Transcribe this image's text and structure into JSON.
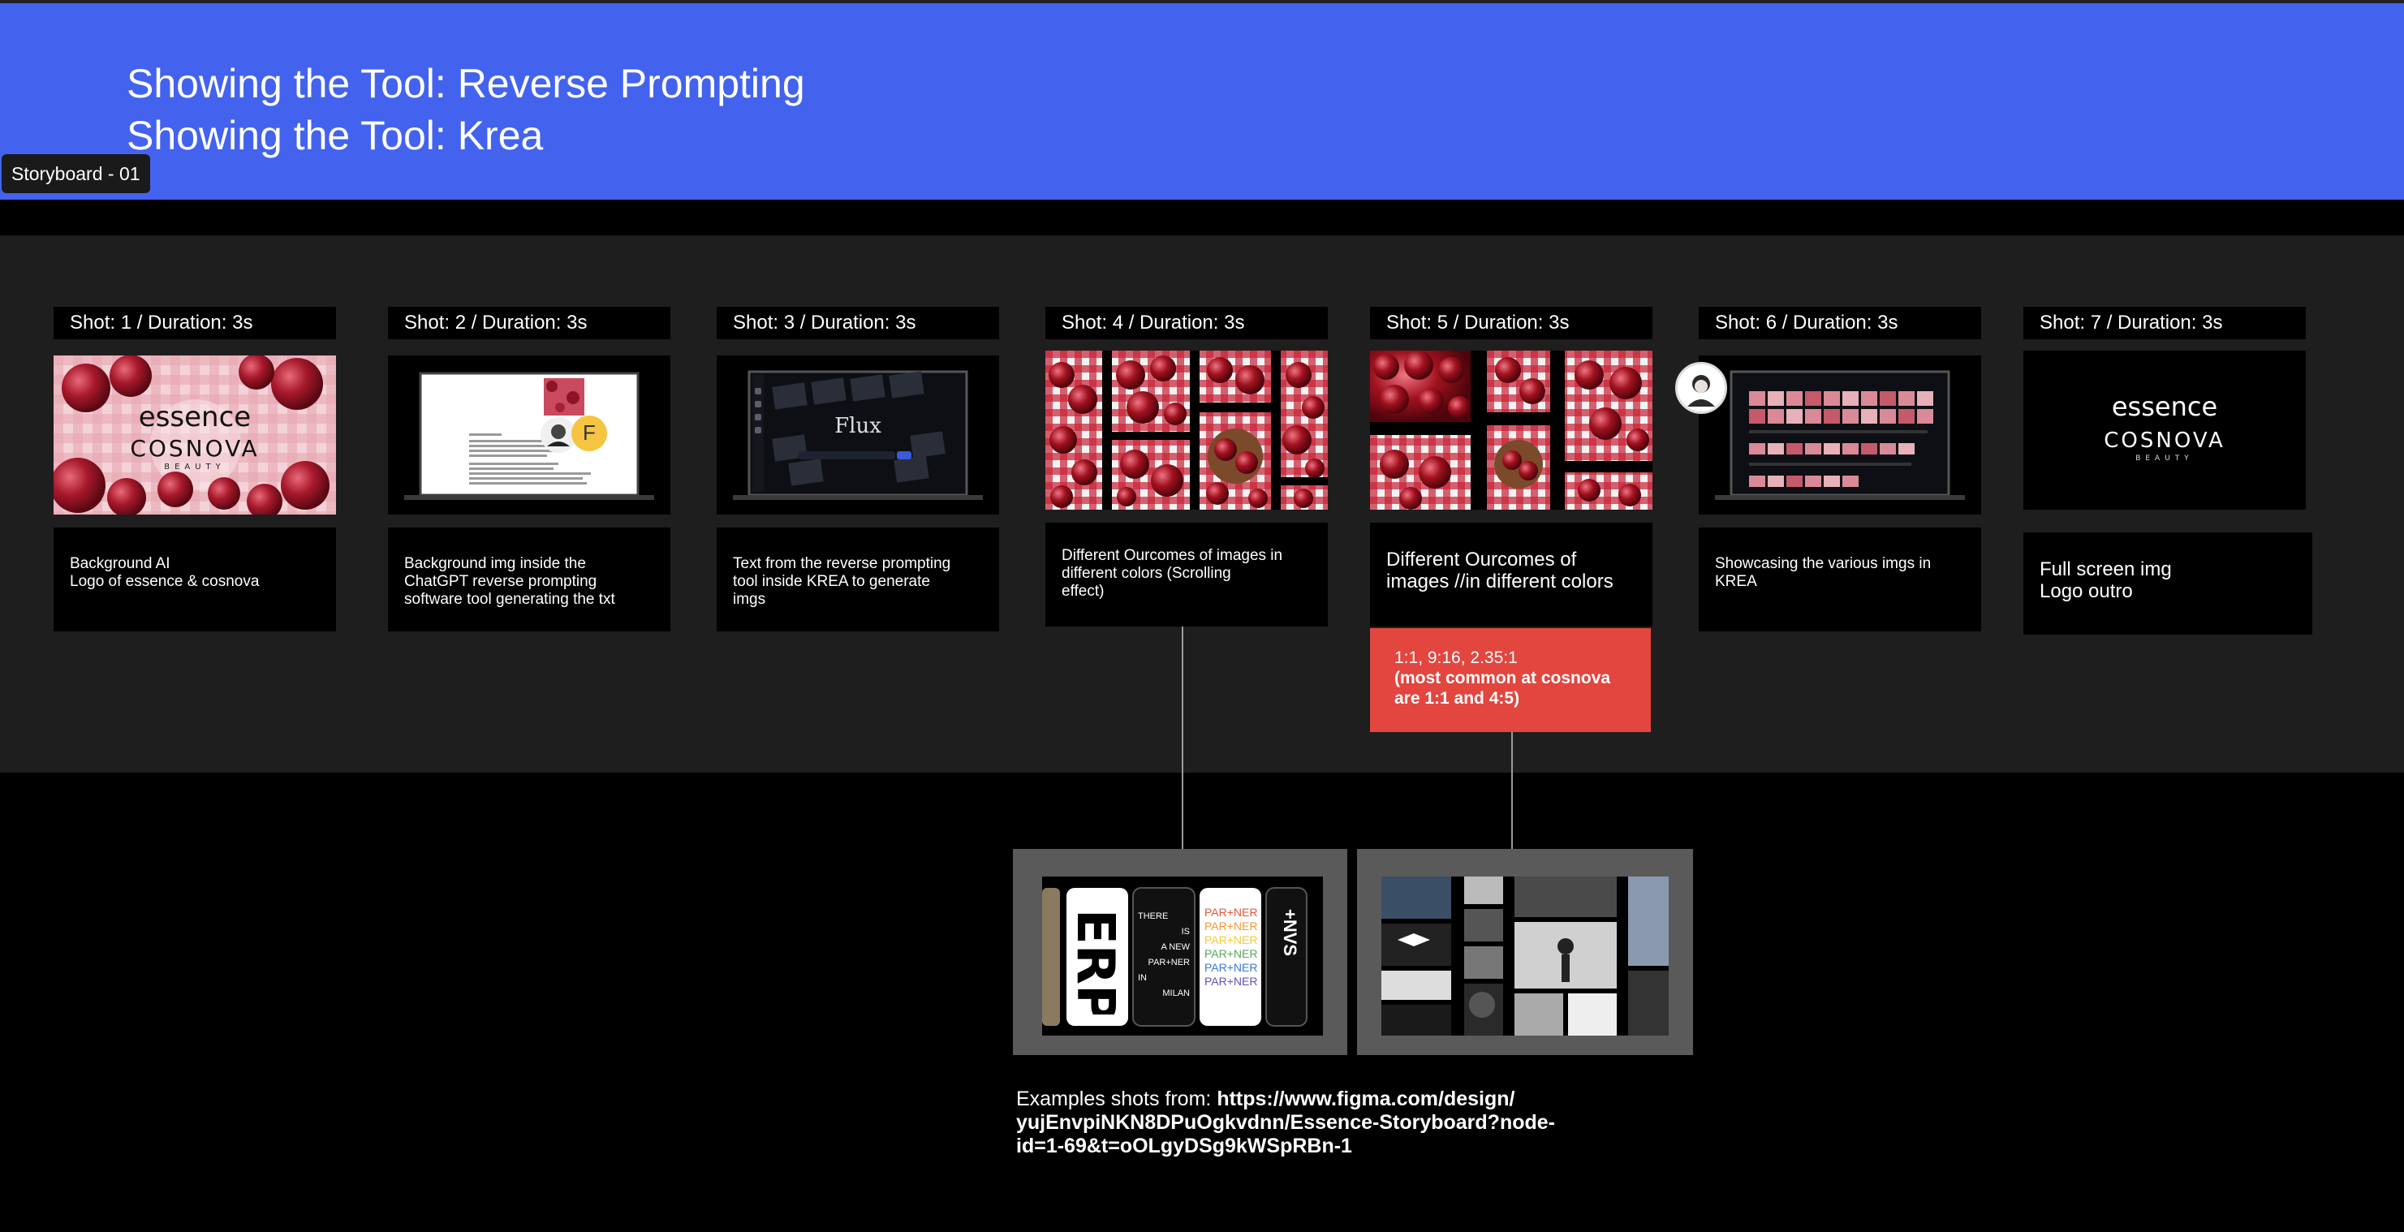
{
  "header": {
    "title_line1": "Showing the Tool: Reverse Prompting",
    "title_line2": "Showing the Tool: Krea",
    "storyboard_tag": "Storyboard - 01"
  },
  "shots": [
    {
      "label": "Shot: 1 / Duration: 3s",
      "desc": [
        "Background AI",
        "Logo of essence & cosnova"
      ]
    },
    {
      "label": "Shot: 2 / Duration: 3s",
      "desc": [
        "Background img inside the",
        "ChatGPT reverse prompting",
        "software tool generating the txt"
      ]
    },
    {
      "label": "Shot: 3 / Duration: 3s",
      "desc": [
        "Text from the reverse prompting",
        "tool inside KREA to generate",
        "imgs"
      ]
    },
    {
      "label": "Shot: 4 / Duration: 3s",
      "desc": [
        "Different Ourcomes of images in",
        "different colors (Scrolling",
        "effect)"
      ]
    },
    {
      "label": "Shot: 5 / Duration: 3s",
      "desc": [
        "Different Ourcomes of",
        "images //in different colors"
      ]
    },
    {
      "label": "Shot: 6 / Duration: 3s",
      "desc": [
        "Showcasing the various imgs in",
        "KREA"
      ]
    },
    {
      "label": "Shot: 7 / Duration: 3s",
      "desc": [
        "Full screen img",
        "Logo outro"
      ]
    }
  ],
  "ratio_note": {
    "line1": "1:1, 9:16, 2.35:1",
    "line2": "(most common at cosnova",
    "line3": "are 1:1 and 4:5)"
  },
  "logos": {
    "essence": "essence",
    "cosnova": "COSNOVA",
    "beauty": "BEAUTY",
    "flux": "Flux",
    "avatar_letter": "F"
  },
  "example_mockup": {
    "big_letters": "ERP",
    "there_lines": [
      "THERE",
      "IS",
      "A NEW",
      "PAR+NER",
      "IN",
      "MILAN"
    ],
    "partner": "PAR+NER",
    "side": "+NVS"
  },
  "caption": {
    "prefix": "Examples shots from: ",
    "link": "https://www.figma.com/design/yujEnvpiNKN8DPuOgkvdnn/Essence-Storyboard?node-id=1-69&t=oOLgyDSg9kWSpRBn-1",
    "link_line1": "https://www.figma.com/design/",
    "link_line2": "yujEnvpiNKN8DPuOgkvdnn/Essence-Storyboard?node-",
    "link_line3": "id=1-69&t=oOLgyDSg9kWSpRBn-1"
  },
  "colors": {
    "header": "#4363ee",
    "band": "#1e1e1e",
    "note": "#e2463f",
    "example_frame": "#5a5a5a"
  }
}
